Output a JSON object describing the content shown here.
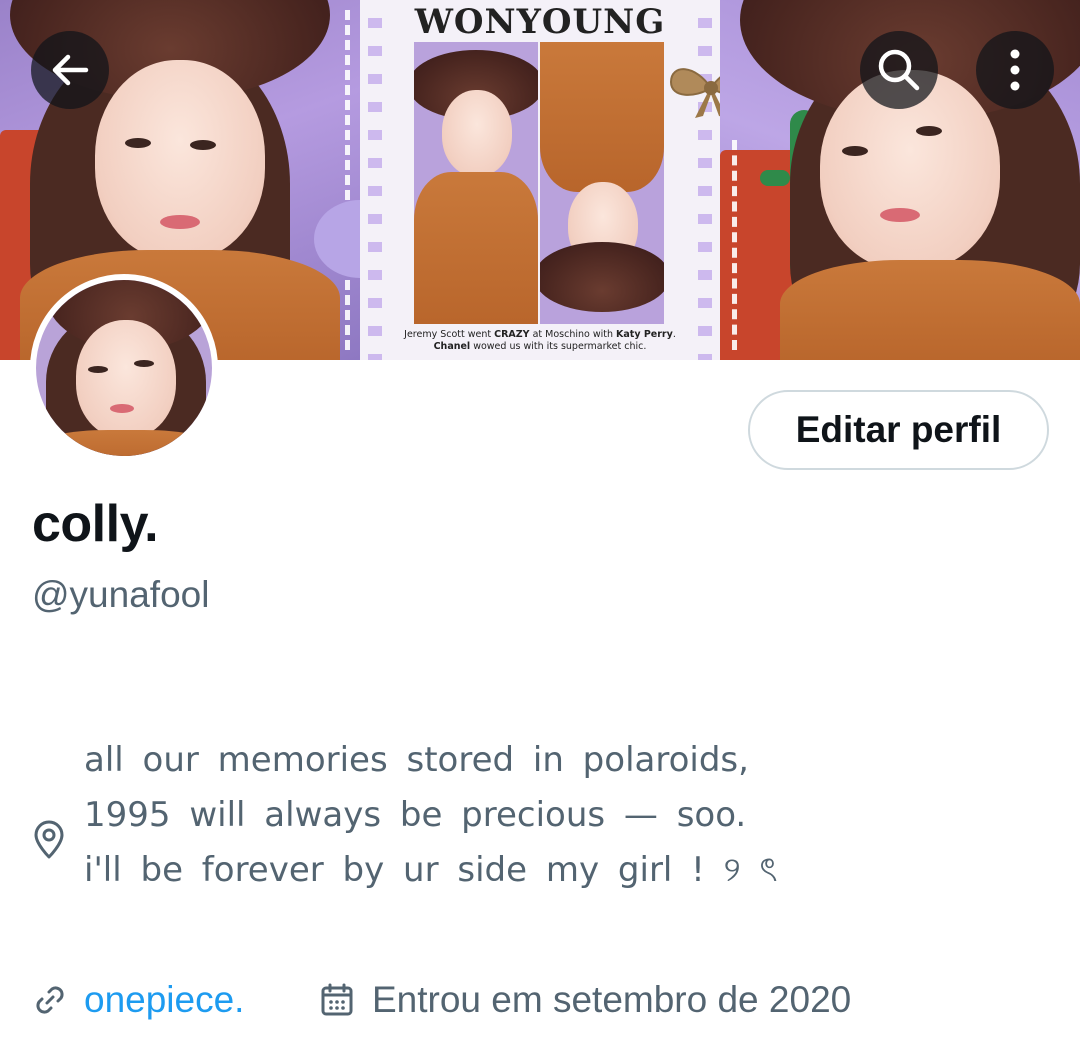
{
  "banner": {
    "magazine_title": "WONYOUNG",
    "caption": {
      "line1_a": "Jeremy Scott went ",
      "line1_b": "CRAZY",
      "line1_c": " at Moschino with ",
      "line1_d": "Katy Perry",
      "line1_e": ".",
      "line2_a": "Chanel",
      "line2_b": " wowed us with its supermarket chic."
    }
  },
  "header_buttons": {
    "back": "arrow-left-icon",
    "search": "search-icon",
    "more": "more-vertical-icon"
  },
  "profile": {
    "edit_button_label": "Editar perfil",
    "display_name": "colly.",
    "handle": "@yunafool",
    "bio_lines": [
      "all our memories stored in polaroids,",
      "1995 will always be precious — soo.",
      "i'll be forever by ur side my girl ! ୨ ৎ"
    ],
    "link_text": "onepiece.",
    "joined_text": "Entrou em setembro de 2020"
  },
  "colors": {
    "text_primary": "#0f1419",
    "text_secondary": "#536471",
    "link": "#1d9bf0",
    "button_border": "#cfd9de"
  }
}
